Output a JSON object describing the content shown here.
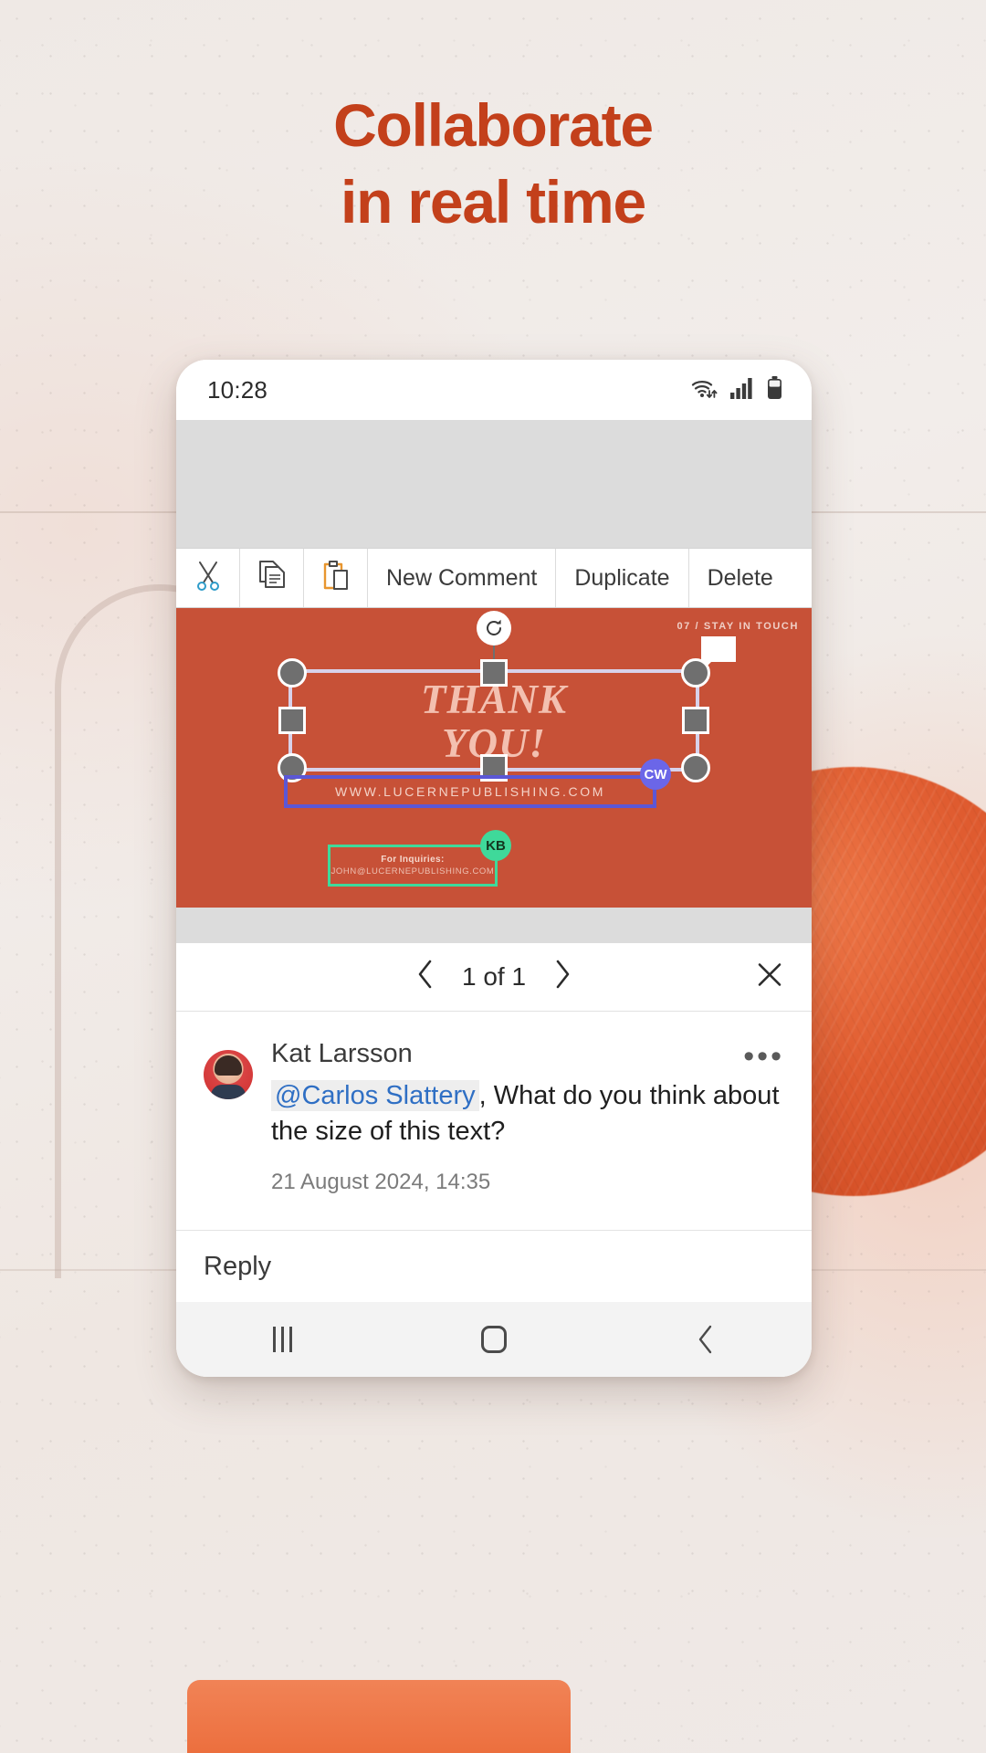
{
  "headline": {
    "line1": "Collaborate",
    "line2": "in real time",
    "color": "#c3401b"
  },
  "phone": {
    "status": {
      "time": "10:28",
      "icons": [
        "wifi-icon",
        "cellular-signal-icon",
        "battery-icon"
      ]
    },
    "context_toolbar": {
      "items": [
        {
          "name": "cut",
          "label": "",
          "icon": "scissors-icon"
        },
        {
          "name": "copy",
          "label": "",
          "icon": "copy-icon"
        },
        {
          "name": "paste",
          "label": "",
          "icon": "clipboard-icon"
        },
        {
          "name": "new-comment",
          "label": "New Comment",
          "icon": ""
        },
        {
          "name": "duplicate",
          "label": "Duplicate",
          "icon": ""
        },
        {
          "name": "delete",
          "label": "Delete",
          "icon": ""
        }
      ]
    },
    "slide": {
      "background_color": "#c75137",
      "kicker": "07  /  STAY IN TOUCH",
      "title_line1": "THANK",
      "title_line2": "YOU!",
      "url": "WWW.LUCERNEPUBLISHING.COM",
      "url_box_color": "#5b57d6",
      "url_badge": "CW",
      "url_badge_color": "#6b66e8",
      "inquiries_label": "For Inquiries:",
      "inquiries_email": "JOHN@LUCERNEPUBLISHING.COM",
      "inquiries_box_color": "#3fd99a",
      "inquiries_badge": "KB",
      "inquiries_badge_color": "#3fd99a"
    },
    "pager": {
      "prev": "‹",
      "count": "1 of 1",
      "next": "›",
      "close": "close-icon"
    },
    "comment": {
      "author": "Kat Larsson",
      "mention": "@Carlos Slattery",
      "text": ", What do you think about the size of this text?",
      "timestamp": "21 August 2024, 14:35",
      "more": "•••"
    },
    "reply": {
      "label": "Reply"
    },
    "navbar": {
      "recents": "recents-icon",
      "home": "home-icon",
      "back": "back-icon"
    }
  }
}
